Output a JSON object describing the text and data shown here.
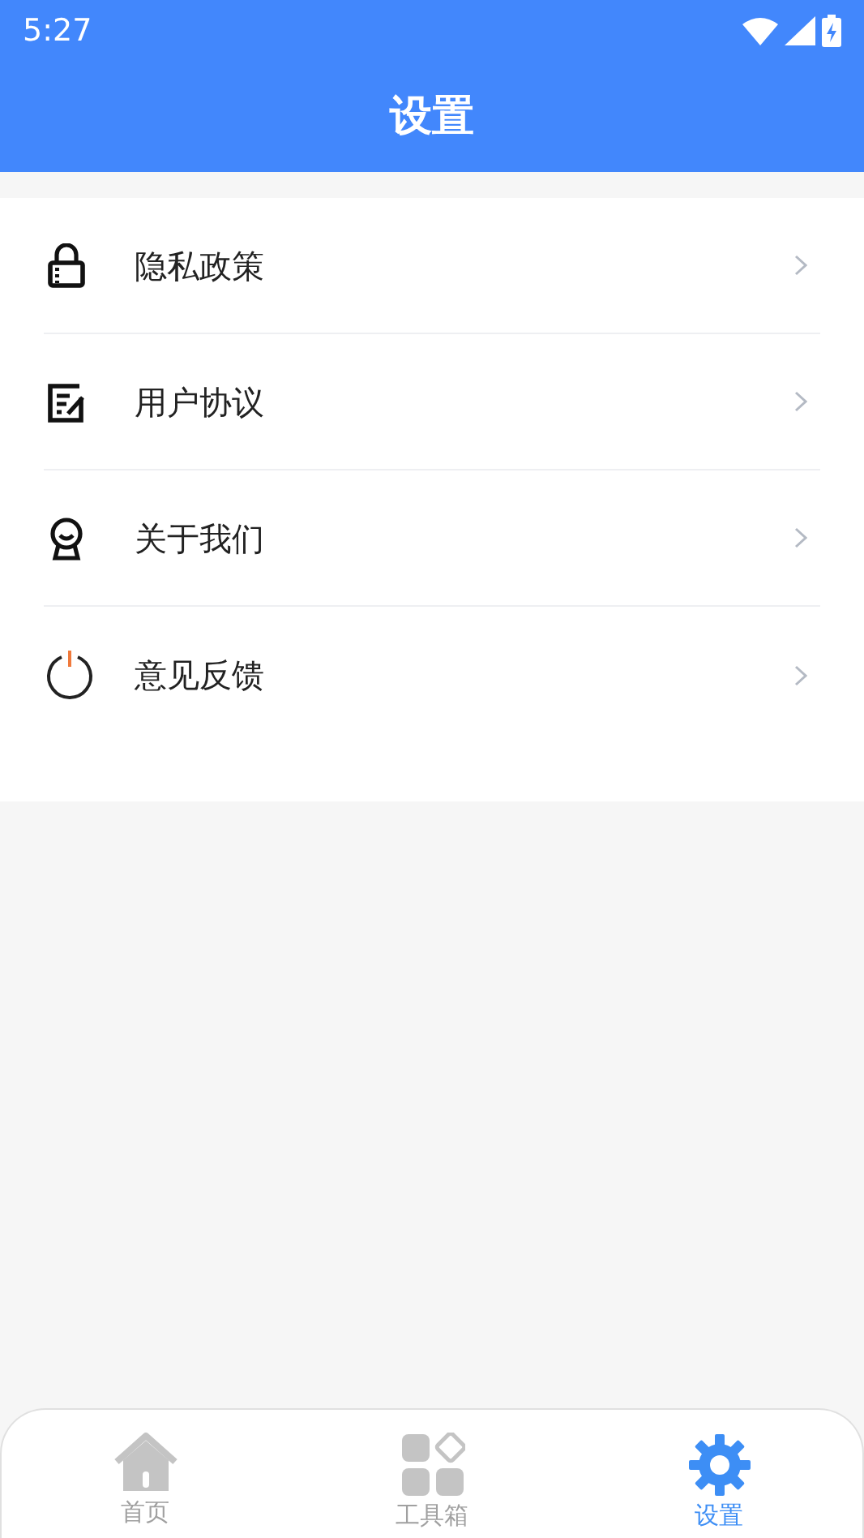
{
  "status_bar": {
    "time": "5:27"
  },
  "header": {
    "title": "设置"
  },
  "menu": [
    {
      "kind": "lock",
      "label": "隐私政策"
    },
    {
      "kind": "note",
      "label": "用户协议"
    },
    {
      "kind": "person",
      "label": "关于我们"
    },
    {
      "kind": "power",
      "label": "意见反馈"
    }
  ],
  "tab_bar": [
    {
      "kind": "home",
      "label": "首页",
      "selected": false
    },
    {
      "kind": "tools",
      "label": "工具箱",
      "selected": false
    },
    {
      "kind": "gear",
      "label": "设置",
      "selected": true
    }
  ]
}
